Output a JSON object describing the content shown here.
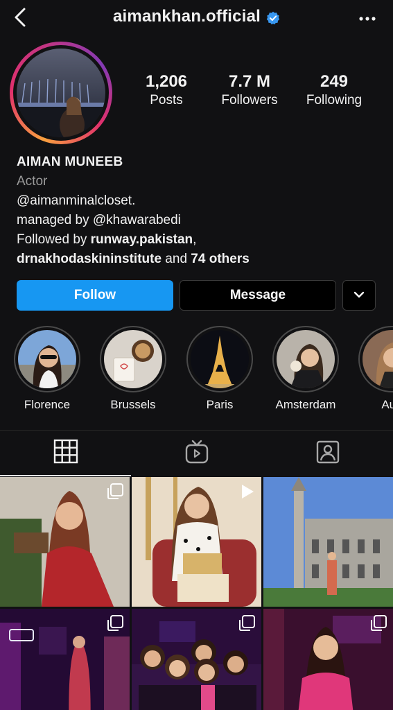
{
  "header": {
    "username": "aimankhan.official",
    "verified": true,
    "icons": {
      "back": "back-chevron-icon",
      "more": "more-horizontal-icon",
      "verified": "verified-badge-icon"
    }
  },
  "stats": {
    "posts": {
      "value": "1,206",
      "label": "Posts"
    },
    "followers": {
      "value": "7.7 M",
      "label": "Followers"
    },
    "following": {
      "value": "249",
      "label": "Following"
    }
  },
  "bio": {
    "name": "AIMAN MUNEEB",
    "category": "Actor",
    "line1": "@aimanminalcloset.",
    "line2": "managed by @khawarabedi",
    "followed_by_prefix": "Followed by ",
    "followed_by_user1": "runway.pakistan",
    "followed_by_sep": ",",
    "followed_by_user2": "drnakhodaskininstitute",
    "followed_by_and": " and ",
    "followed_by_others": "74 others"
  },
  "actions": {
    "follow_label": "Follow",
    "message_label": "Message",
    "more_icon": "chevron-down-icon"
  },
  "highlights": [
    {
      "label": "Florence"
    },
    {
      "label": "Brussels"
    },
    {
      "label": "Paris"
    },
    {
      "label": "Amsterdam"
    },
    {
      "label": "Aus"
    }
  ],
  "tabs": [
    {
      "icon": "grid-icon",
      "active": true
    },
    {
      "icon": "igtv-icon",
      "active": false
    },
    {
      "icon": "tagged-icon",
      "active": false
    }
  ],
  "posts": [
    {
      "type": "carousel"
    },
    {
      "type": "video"
    },
    {
      "type": "photo"
    },
    {
      "type": "carousel"
    },
    {
      "type": "carousel"
    },
    {
      "type": "carousel"
    }
  ],
  "colors": {
    "background": "#111113",
    "follow_button": "#1797f2",
    "verified": "#3897f0"
  }
}
